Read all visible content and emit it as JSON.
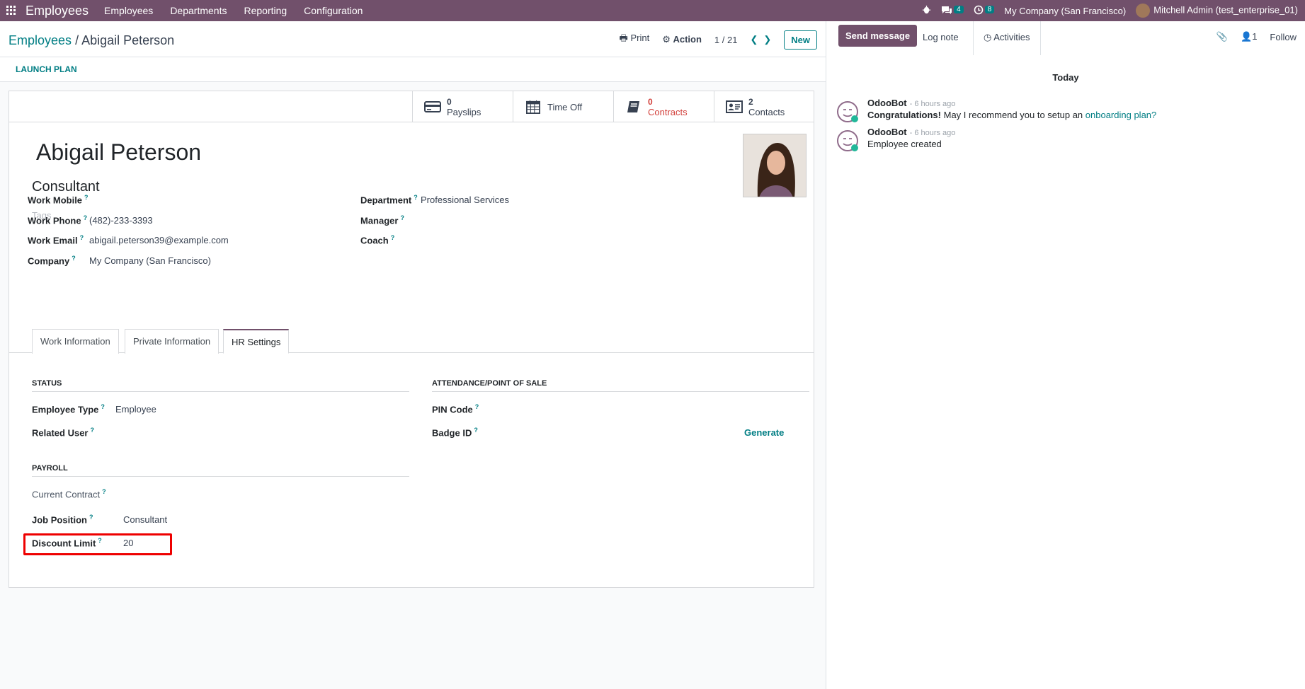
{
  "navbar": {
    "brand": "Employees",
    "menu": [
      "Employees",
      "Departments",
      "Reporting",
      "Configuration"
    ],
    "messages_count": "4",
    "activities_count": "8",
    "company": "My Company (San Francisco)",
    "user": "Mitchell Admin (test_enterprise_01)"
  },
  "control": {
    "breadcrumb_parent": "Employees",
    "breadcrumb_sep": "/",
    "breadcrumb_current": "Abigail Peterson",
    "print": "Print",
    "action": "Action",
    "pager": "1 / 21",
    "new": "New"
  },
  "statusbar": {
    "launch_plan": "LAUNCH PLAN"
  },
  "smart_buttons": {
    "payslips": {
      "count": "0",
      "label": "Payslips"
    },
    "timeoff": {
      "label": "Time Off"
    },
    "contracts": {
      "count": "0",
      "label": "Contracts"
    },
    "contacts": {
      "count": "2",
      "label": "Contacts"
    }
  },
  "employee": {
    "name": "Abigail Peterson",
    "job_title": "Consultant",
    "tags_placeholder": "Tags"
  },
  "fields": {
    "work_mobile": {
      "label": "Work Mobile",
      "value": ""
    },
    "work_phone": {
      "label": "Work Phone",
      "value": "(482)-233-3393"
    },
    "work_email": {
      "label": "Work Email",
      "value": "abigail.peterson39@example.com"
    },
    "company": {
      "label": "Company",
      "value": "My Company (San Francisco)"
    },
    "department": {
      "label": "Department",
      "value": "Professional Services"
    },
    "manager": {
      "label": "Manager",
      "value": ""
    },
    "coach": {
      "label": "Coach",
      "value": ""
    }
  },
  "tabs": [
    "Work Information",
    "Private Information",
    "HR Settings"
  ],
  "hr": {
    "status_title": "STATUS",
    "employee_type_label": "Employee Type",
    "employee_type": "Employee",
    "related_user_label": "Related User",
    "payroll_title": "PAYROLL",
    "current_contract_label": "Current Contract",
    "job_position_label": "Job Position",
    "job_position": "Consultant",
    "discount_limit_label": "Discount Limit",
    "discount_limit": "20",
    "attendance_title": "ATTENDANCE/POINT OF SALE",
    "pin_label": "PIN Code",
    "badge_label": "Badge ID",
    "generate": "Generate"
  },
  "help_mark": "?",
  "chatter": {
    "send_message": "Send message",
    "log_note": "Log note",
    "activities": "Activities",
    "followers_count": "1",
    "follow": "Follow",
    "today": "Today",
    "messages": [
      {
        "author": "OdooBot",
        "time": "- 6 hours ago",
        "bold": "Congratulations!",
        "text": " May I recommend you to setup an ",
        "link": "onboarding plan?"
      },
      {
        "author": "OdooBot",
        "time": "- 6 hours ago",
        "text": "Employee created"
      }
    ]
  }
}
